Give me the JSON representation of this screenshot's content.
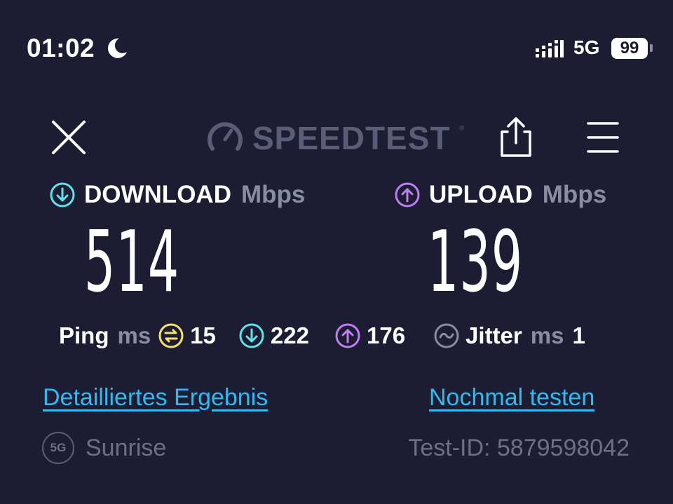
{
  "status_bar": {
    "time": "01:02",
    "network": "5G",
    "battery": "99",
    "icons": [
      "moon-icon",
      "signal-icon"
    ]
  },
  "header": {
    "logo_text": "SPEEDTEST",
    "logo_mark": "®",
    "icons": [
      "close-icon",
      "share-icon",
      "menu-icon"
    ]
  },
  "download": {
    "label": "DOWNLOAD",
    "unit": "Mbps",
    "value": "514",
    "icon": "arrow-down-circle-icon",
    "accent": "#5fe3e8"
  },
  "upload": {
    "label": "UPLOAD",
    "unit": "Mbps",
    "value": "139",
    "icon": "arrow-up-circle-icon",
    "accent": "#bf7ef2"
  },
  "ping": {
    "label": "Ping",
    "unit": "ms",
    "idle_value": "15",
    "download_value": "222",
    "upload_value": "176",
    "idle_accent": "#f7e36a"
  },
  "jitter": {
    "label": "Jitter",
    "unit": "ms",
    "value": "1"
  },
  "links": {
    "detail": "Detailliertes Ergebnis",
    "retest": "Nochmal testen"
  },
  "footer": {
    "badge": "5G",
    "provider": "Sunrise",
    "test_id": "Test-ID: 5879598042"
  }
}
